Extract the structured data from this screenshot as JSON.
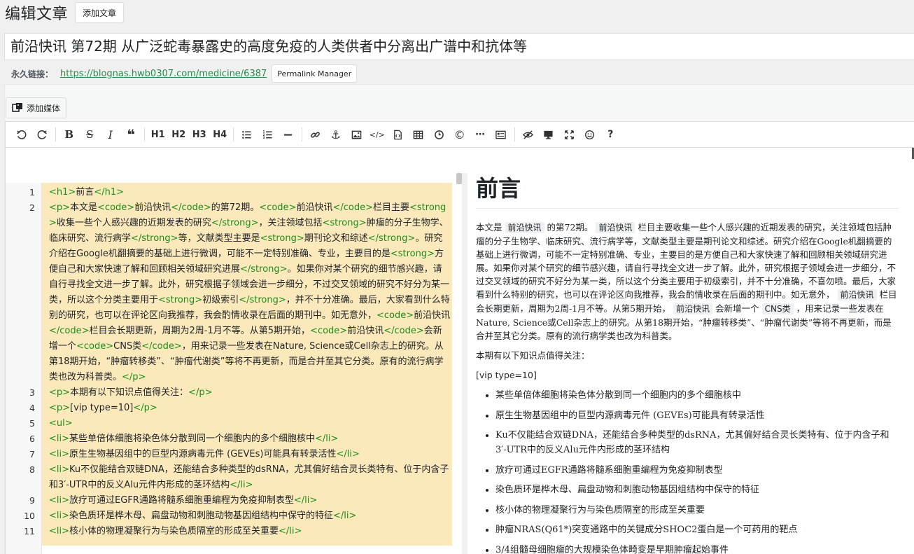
{
  "header": {
    "title": "编辑文章",
    "add_new_label": "添加文章"
  },
  "post_title": "前沿快讯 第72期 从广泛蛇毒暴露史的高度免疫的人类供者中分离出广谱中和抗体等",
  "permalink": {
    "label": "永久链接：",
    "url": "https://blognas.hwb0307.com/medicine/6387",
    "manager_label": "Permalink Manager"
  },
  "media_button_label": "添加媒体",
  "toolbar": {
    "items": [
      "undo-icon",
      "redo-icon",
      "|",
      "bold-icon",
      "strikethrough-icon",
      "italic-icon",
      "quote-icon",
      "|",
      "H1",
      "H2",
      "H3",
      "H4",
      "|",
      "unordered-list-icon",
      "ordered-list-icon",
      "horizontal-rule-icon",
      "|",
      "link-icon",
      "anchor-icon",
      "image-icon",
      "code-icon",
      "file-code-icon",
      "table-icon",
      "clock-icon",
      "copyright-icon",
      "more-icon",
      "toc-icon",
      "|",
      "preview-icon",
      "desktop-icon",
      "fullscreen-icon",
      "emoji-icon",
      "help-icon"
    ]
  },
  "code_lines": [
    {
      "n": "1",
      "html": "<span class='tag'>&lt;h1&gt;</span>前言<span class='tag'>&lt;/h1&gt;</span>"
    },
    {
      "n": "2",
      "html": "<span class='tag'>&lt;p&gt;</span>本文是<span class='tag'>&lt;code&gt;</span>前沿快讯<span class='tag'>&lt;/code&gt;</span>的第72期。<span class='tag'>&lt;code&gt;</span>前沿快讯<span class='tag'>&lt;/code&gt;</span>栏目主要<span class='tag'>&lt;strong&gt;</span>收集一些个人感兴趣的近期发表的研究<span class='tag'>&lt;/strong&gt;</span>，关注领域包括<span class='tag'>&lt;strong&gt;</span>肿瘤的分子生物学、临床研究、流行病学<span class='tag'>&lt;/strong&gt;</span>等，文献类型主要是<span class='tag'>&lt;strong&gt;</span>期刊论文和综述<span class='tag'>&lt;/strong&gt;</span>。研究介绍在Google机翻摘要的基础上进行微调，可能不一定特别准确、专业，主要目的是<span class='tag'>&lt;strong&gt;</span>方便自己和大家快速了解和回顾相关领域研究进展<span class='tag'>&lt;/strong&gt;</span>。如果你对某个研究的细节感兴趣，请自行寻找全文进一步了解。此外，研究根据子领域会进一步细分，不过交叉领域的研究不好分为某一类，所以这个分类主要用于<span class='tag'>&lt;strong&gt;</span>初级索引<span class='tag'>&lt;/strong&gt;</span>，并不十分准确。最后，大家看到什么特别的研究，也可以在评论区向我推荐，我会酌情收录在后面的期刊中。如无意外，<span class='tag'>&lt;code&gt;</span>前沿快讯<span class='tag'>&lt;/code&gt;</span>栏目会长期更新，周期为2周-1月不等。从第5期开始，<span class='tag'>&lt;code&gt;</span>前沿快讯<span class='tag'>&lt;/code&gt;</span>会新增一个<span class='tag'>&lt;code&gt;</span>CNS类<span class='tag'>&lt;/code&gt;</span>，用来记录一些发表在Nature, Science或Cell杂志上的研究。从第18期开始，“肿瘤转移类”、“肿瘤代谢类”等将不再更新，而是合并至其它分类。原有的流行病学类也改为科普类。<span class='tag'>&lt;/p&gt;</span>"
    },
    {
      "n": "3",
      "html": "<span class='tag'>&lt;p&gt;</span>本期有以下知识点值得关注：<span class='tag'>&lt;/p&gt;</span>"
    },
    {
      "n": "4",
      "html": "<span class='tag'>&lt;p&gt;</span>[vip type=10]<span class='tag'>&lt;/p&gt;</span>"
    },
    {
      "n": "5",
      "html": "<span class='tag'>&lt;ul&gt;</span>"
    },
    {
      "n": "6",
      "html": "<span class='tag'>&lt;li&gt;</span>某些单倍体细胞将染色体分散到同一个细胞内的多个细胞核中<span class='tag'>&lt;/li&gt;</span>"
    },
    {
      "n": "7",
      "html": "<span class='tag'>&lt;li&gt;</span>原生生物基因组中的巨型内源病毒元件 (GEVEs)可能具有转录活性<span class='tag'>&lt;/li&gt;</span>"
    },
    {
      "n": "8",
      "html": "<span class='tag'>&lt;li&gt;</span>Ku不仅能结合双链DNA，还能结合多种类型的dsRNA，尤其偏好结合灵长类特有、位于内含子和3′-UTR中的反义Alu元件内形成的茎环结构<span class='tag'>&lt;/li&gt;</span>"
    },
    {
      "n": "9",
      "html": "<span class='tag'>&lt;li&gt;</span>放疗可通过EGFR通路将髓系细胞重编程为免疫抑制表型<span class='tag'>&lt;/li&gt;</span>"
    },
    {
      "n": "10",
      "html": "<span class='tag'>&lt;li&gt;</span>染色质环是桦木母、扁盘动物和刺胞动物基因组结构中保守的特征<span class='tag'>&lt;/li&gt;</span>"
    },
    {
      "n": "11",
      "html": "<span class='tag'>&lt;li&gt;</span>核小体的物理凝聚行为与染色质隔室的形成至关重要<span class='tag'>&lt;/li&gt;</span>"
    }
  ],
  "preview": {
    "h1": "前言",
    "p1_parts": [
      {
        "t": "text",
        "v": "本文是"
      },
      {
        "t": "code",
        "v": "前沿快讯"
      },
      {
        "t": "text",
        "v": "的第72期。"
      },
      {
        "t": "code",
        "v": "前沿快讯"
      },
      {
        "t": "text",
        "v": "栏目主要收集一些个人感兴趣的近期发表的研究，关注领域包括肿瘤的分子生物学、临床研究、流行病学等，文献类型主要是期刊论文和综述。研究介绍在Google机翻摘要的基础上进行微调，可能不一定特别准确、专业，主要目的是方便自己和大家快速了解和回顾相关领域研究进展。如果你对某个研究的细节感兴趣，请自行寻找全文进一步了解。此外，研究根据子领域会进一步细分，不过交叉领域的研究不好分为某一类，所以这个分类主要用于初级索引，并不十分准确，不喜勿喷。最后，大家看到什么特别的研究，也可以在评论区向我推荐，我会酌情收录在后面的期刊中。如无意外，"
      },
      {
        "t": "code",
        "v": "前沿快讯"
      },
      {
        "t": "text",
        "v": "栏目会长期更新，周期为2周-1月不等。从第5期开始，"
      },
      {
        "t": "code",
        "v": "前沿快讯"
      },
      {
        "t": "text",
        "v": "会新增一个"
      },
      {
        "t": "code",
        "v": "CNS类"
      },
      {
        "t": "text",
        "v": "，用来记录一些发表在Nature, Science或Cell杂志上的研究。从第18期开始，“肿瘤转移类”、“肿瘤代谢类”等将不再更新，而是合并至其它分类。原有的流行病学类也改为科普类。"
      }
    ],
    "p2": "本期有以下知识点值得关注：",
    "p3": "[vip type=10]",
    "list": [
      "某些单倍体细胞将染色体分散到同一个细胞内的多个细胞核中",
      "原生生物基因组中的巨型内源病毒元件 (GEVEs)可能具有转录活性",
      "Ku不仅能结合双链DNA，还能结合多种类型的dsRNA，尤其偏好结合灵长类特有、位于内含子和3′-UTR中的反义Alu元件内形成的茎环结构",
      "放疗可通过EGFR通路将髓系细胞重编程为免疫抑制表型",
      "染色质环是桦木母、扁盘动物和刺胞动物基因组结构中保守的特征",
      "核小体的物理凝聚行为与染色质隔室的形成至关重要",
      "肿瘤NRAS(Q61*)突变通路中的关键成分SHOC2蛋白是一个可药用的靶点",
      "3/4组髓母细胞瘤的大规模染色体畸变是早期肿瘤起始事件"
    ]
  }
}
